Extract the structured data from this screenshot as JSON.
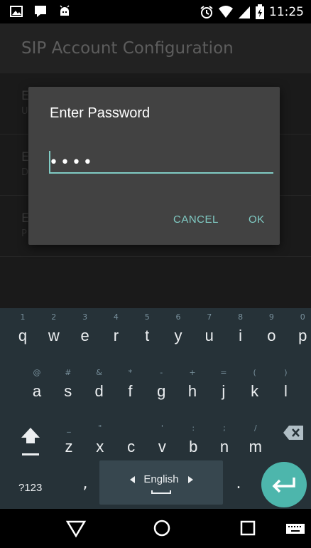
{
  "status_bar": {
    "time": "11:25",
    "icons_left": [
      "image-icon",
      "notification-icon",
      "android-icon"
    ],
    "icons_right": [
      "alarm-icon",
      "wifi-icon",
      "signal-icon",
      "battery-charging-icon"
    ]
  },
  "app_bar": {
    "title": "SIP Account Configuration"
  },
  "background_list": {
    "rows": [
      {
        "title": "E",
        "subtitle": "U"
      },
      {
        "title": "E",
        "subtitle": "D"
      },
      {
        "title": "E",
        "subtitle": "P"
      }
    ]
  },
  "dialog": {
    "title": "Enter Password",
    "password_value": "••••",
    "cancel_label": "CANCEL",
    "ok_label": "OK"
  },
  "keyboard": {
    "row1": [
      {
        "ch": "q",
        "hint": "1"
      },
      {
        "ch": "w",
        "hint": "2"
      },
      {
        "ch": "e",
        "hint": "3"
      },
      {
        "ch": "r",
        "hint": "4"
      },
      {
        "ch": "t",
        "hint": "5"
      },
      {
        "ch": "y",
        "hint": "6"
      },
      {
        "ch": "u",
        "hint": "7"
      },
      {
        "ch": "i",
        "hint": "8"
      },
      {
        "ch": "o",
        "hint": "9"
      },
      {
        "ch": "p",
        "hint": "0"
      }
    ],
    "row2": [
      {
        "ch": "a",
        "hint": "@"
      },
      {
        "ch": "s",
        "hint": "#"
      },
      {
        "ch": "d",
        "hint": "&"
      },
      {
        "ch": "f",
        "hint": "*"
      },
      {
        "ch": "g",
        "hint": "-"
      },
      {
        "ch": "h",
        "hint": "+"
      },
      {
        "ch": "j",
        "hint": "="
      },
      {
        "ch": "k",
        "hint": "("
      },
      {
        "ch": "l",
        "hint": ")"
      }
    ],
    "row3": [
      {
        "ch": "z",
        "hint": "_"
      },
      {
        "ch": "x",
        "hint": "\""
      },
      {
        "ch": "c",
        "hint": ""
      },
      {
        "ch": "v",
        "hint": "'"
      },
      {
        "ch": "b",
        "hint": ":"
      },
      {
        "ch": "n",
        "hint": ";"
      },
      {
        "ch": "m",
        "hint": "/"
      }
    ],
    "symbols_label": "?123",
    "comma_label": ",",
    "period_label": ".",
    "language_label": "English",
    "accent_color": "#4db6ac"
  },
  "nav_bar": {
    "buttons": [
      "back-icon",
      "home-icon",
      "recents-icon",
      "keyboard-icon"
    ]
  }
}
